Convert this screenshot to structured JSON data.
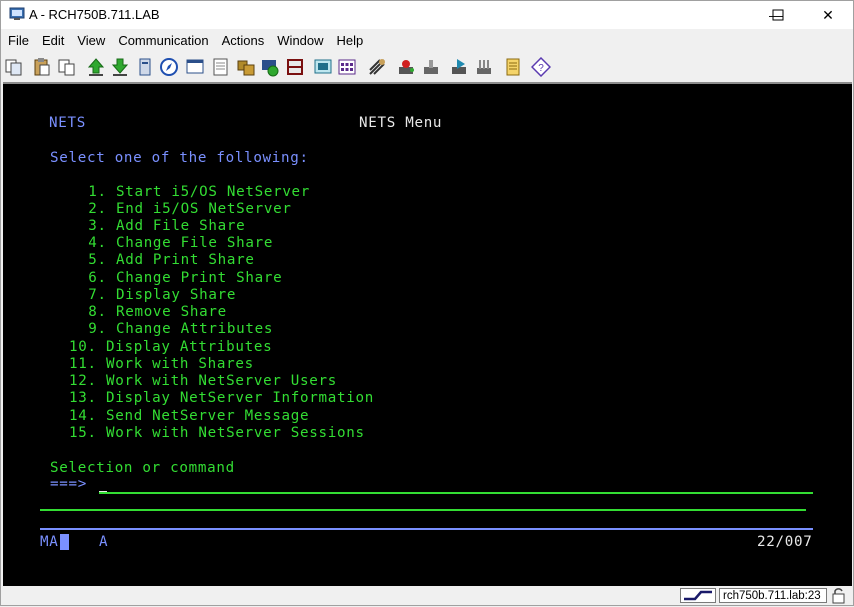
{
  "window": {
    "title": "A - RCH750B.711.LAB",
    "minimize_glyph": "—",
    "maximize_glyph": "☐",
    "close_glyph": "✕"
  },
  "menu": [
    "File",
    "Edit",
    "View",
    "Communication",
    "Actions",
    "Window",
    "Help"
  ],
  "toolbar": {
    "icons": [
      "copy-icon",
      "paste-icon",
      "copy-append-icon",
      "send-file-icon",
      "receive-file-icon",
      "print-screen-icon",
      "navigator-icon",
      "display-icon",
      "macro-icon",
      "keyboard-map-icon",
      "color-map-icon",
      "record-macro-icon",
      "play-macro-icon",
      "keypad-icon",
      "connection-icon",
      "attention-icon",
      "system-request-icon",
      "disconnect-icon",
      "trace-icon",
      "stop-icon",
      "notes-icon",
      "help-icon"
    ]
  },
  "terminal": {
    "system_name": "NETS",
    "menu_title": "NETS Menu",
    "instruction": "Select one of the following:",
    "options": [
      " 1. Start i5/OS NetServer",
      " 2. End i5/OS NetServer",
      " 3. Add File Share",
      " 4. Change File Share",
      " 5. Add Print Share",
      " 6. Change Print Share",
      " 7. Display Share",
      " 8. Remove Share",
      " 9. Change Attributes",
      "10. Display Attributes",
      "11. Work with Shares",
      "12. Work with NetServer Users",
      "13. Display NetServer Information",
      "14. Send NetServer Message",
      "15. Work with NetServer Sessions"
    ],
    "prompt_label": "Selection or command",
    "prompt_arrow": "===>",
    "oia_left": "MA",
    "oia_mode": "A",
    "cursor_position": "22/007"
  },
  "statusbar": {
    "session_host": "rch750b.711.lab:23"
  },
  "colors": {
    "terminal_bg": "#000000",
    "field_green": "#33dd33",
    "label_blue": "#7a90ff"
  }
}
